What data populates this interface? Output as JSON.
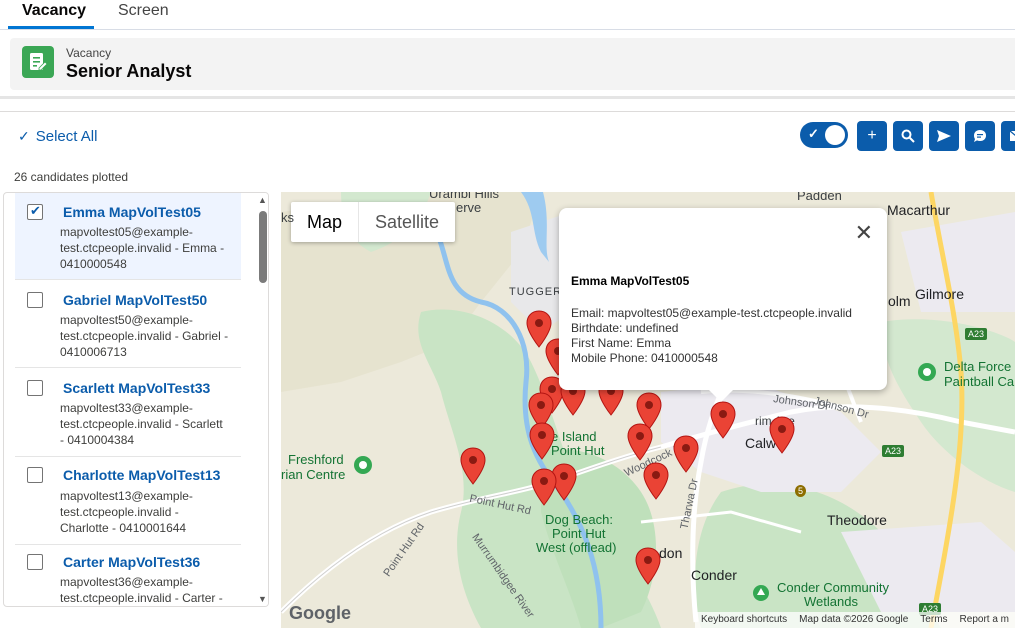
{
  "tabs": [
    {
      "label": "Vacancy"
    },
    {
      "label": "Screen"
    }
  ],
  "record": {
    "object_label": "Vacancy",
    "title": "Senior Analyst",
    "icon": "document-edit-icon"
  },
  "toolbar": {
    "select_all": "Select All",
    "toggle_on": true,
    "buttons": [
      {
        "icon": "plus-icon"
      },
      {
        "icon": "search-icon"
      },
      {
        "icon": "send-icon"
      },
      {
        "icon": "chat-icon"
      },
      {
        "icon": "email-icon"
      }
    ]
  },
  "plotted_count": "26 candidates plotted",
  "candidates": [
    {
      "name": "Emma MapVolTest05",
      "line1": "mapvoltest05@example-",
      "line2": "test.ctcpeople.invalid - Emma -",
      "line3": "0410000548",
      "checked": true
    },
    {
      "name": "Gabriel MapVolTest50",
      "line1": "mapvoltest50@example-",
      "line2": "test.ctcpeople.invalid - Gabriel -",
      "line3": "0410006713",
      "checked": false
    },
    {
      "name": "Scarlett MapVolTest33",
      "line1": "mapvoltest33@example-",
      "line2": "test.ctcpeople.invalid - Scarlett",
      "line3": "- 0410004384",
      "checked": false
    },
    {
      "name": "Charlotte MapVolTest13",
      "line1": "mapvoltest13@example-",
      "line2": "test.ctcpeople.invalid -",
      "line3": "Charlotte - 0410001644",
      "checked": false
    },
    {
      "name": "Carter MapVolTest36",
      "line1": "mapvoltest36@example-",
      "line2": "test.ctcpeople.invalid - Carter -",
      "line3": "",
      "checked": false
    }
  ],
  "map": {
    "type_buttons": [
      "Map",
      "Satellite"
    ],
    "labels": {
      "paddys": "Padden",
      "macarthur": "Macarthur",
      "gilmore": "Gilmore",
      "olm": "olm",
      "tuggeranong": "TUGGERA",
      "urambi": "Urambi Hills",
      "reserve": "erve",
      "ks": "ks",
      "freshford1": "Freshford",
      "freshford2": "rian Centre",
      "pine1": "e Island",
      "pine2": "Point Hut",
      "dog1": "Dog Beach:",
      "dog2": "Point Hut",
      "dog3": "West (offlead)",
      "calwell": "Calwel",
      "theodore": "Theodore",
      "conder": "Conder",
      "conder_comm1": "Conder Community",
      "conder_comm2": "Wetlands",
      "delta1": "Delta Force",
      "delta2": "Paintball Ca",
      "don": "don",
      "rd_pointhut": "Point Hut Rd",
      "rd_pointhut2": "Point Hut Rd",
      "rd_johnson": "Johnson Dr",
      "rd_johnson2": "Johnson Dr",
      "rd_woodcock": "Woodcock Dr",
      "rd_tharwa": "Tharwa Dr",
      "rd_murrumbidgee": "Murrumbidgee River",
      "rd_rim": "rim Ave",
      "rd_a23a": "A23",
      "rd_a23b": "A23",
      "rd_a23c": "A23",
      "rd_5": "5"
    },
    "popup": {
      "title": "Emma MapVolTest05",
      "email": "Email: mapvoltest05@example-test.ctcpeople.invalid",
      "birthdate": "Birthdate: undefined",
      "first_name": "First Name: Emma",
      "mobile": "Mobile Phone: 0410000548"
    },
    "google_logo": "Google",
    "attribution": [
      "Keyboard shortcuts",
      "Map data ©2026 Google",
      "Terms",
      "Report a m"
    ]
  }
}
